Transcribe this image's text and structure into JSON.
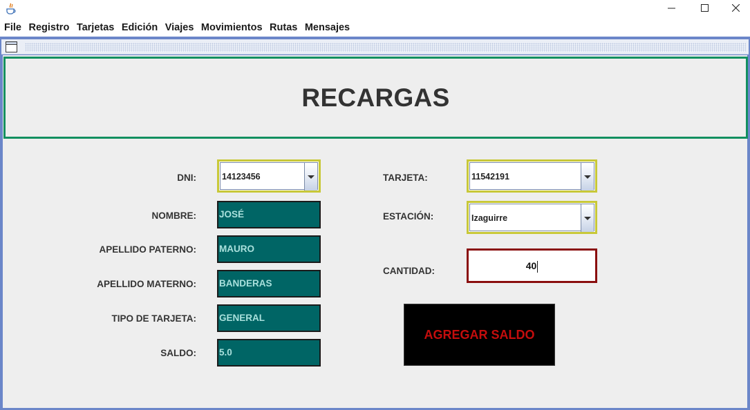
{
  "window": {
    "icon": "java-cup-icon",
    "controls": [
      "minimize-icon",
      "maximize-icon",
      "close-icon"
    ]
  },
  "menu": [
    "File",
    "Registro",
    "Tarjetas",
    "Edición",
    "Viajes",
    "Movimientos",
    "Rutas",
    "Mensajes"
  ],
  "header": {
    "title": "RECARGAS"
  },
  "form": {
    "dni": {
      "label": "DNI:",
      "value": "14123456"
    },
    "nombre": {
      "label": "NOMBRE:",
      "value": "JOSÉ"
    },
    "apellido_paterno": {
      "label": "APELLIDO PATERNO:",
      "value": "MAURO"
    },
    "apellido_materno": {
      "label": "APELLIDO MATERNO:",
      "value": "BANDERAS"
    },
    "tipo_tarjeta": {
      "label": "TIPO DE TARJETA:",
      "value": "GENERAL"
    },
    "saldo": {
      "label": "SALDO:",
      "value": "5.0"
    },
    "tarjeta": {
      "label": "TARJETA:",
      "value": "11542191"
    },
    "estacion": {
      "label": "ESTACIÓN:",
      "value": "Izaguirre"
    },
    "cantidad": {
      "label": "CANTIDAD:",
      "value": "40"
    }
  },
  "actions": {
    "agregar_label": "AGREGAR SALDO"
  },
  "colors": {
    "header_border": "#129060",
    "field_bg": "#006565",
    "combo_border": "#c8c838",
    "cantidad_border": "#8a0e0e",
    "button_text": "#c40d0d"
  }
}
